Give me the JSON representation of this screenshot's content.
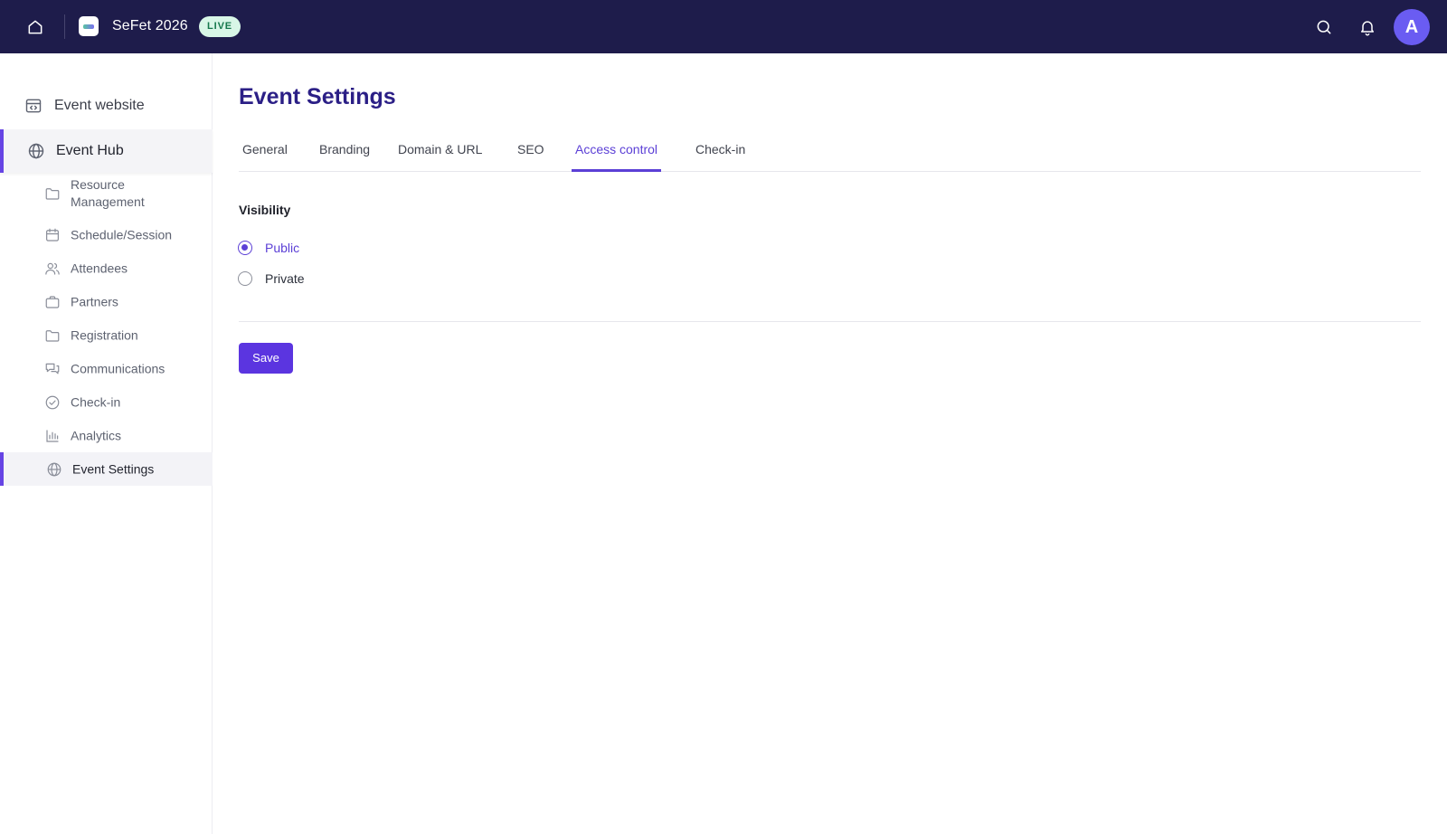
{
  "topbar": {
    "event_name": "SeFet 2026",
    "status_badge": "LIVE",
    "avatar_initial": "A",
    "icons": [
      "home-icon",
      "search-icon",
      "bell-icon"
    ]
  },
  "sidebar": {
    "event_website": "Event website",
    "event_hub": "Event Hub",
    "items": [
      {
        "label": "Resource Management",
        "icon": "folder-icon"
      },
      {
        "label": "Schedule/Session",
        "icon": "calendar-icon"
      },
      {
        "label": "Attendees",
        "icon": "users-icon"
      },
      {
        "label": "Partners",
        "icon": "briefcase-icon"
      },
      {
        "label": "Registration",
        "icon": "folder-icon"
      },
      {
        "label": "Communications",
        "icon": "chat-icon"
      },
      {
        "label": "Check-in",
        "icon": "check-circle-icon"
      },
      {
        "label": "Analytics",
        "icon": "bar-chart-icon"
      },
      {
        "label": "Event Settings",
        "icon": "globe-icon",
        "active": true
      }
    ]
  },
  "main": {
    "title": "Event Settings",
    "tabs": [
      "General",
      "Branding",
      "Domain & URL",
      "SEO",
      "Access control",
      "Check-in"
    ],
    "active_tab": "Access control",
    "visibility_label": "Visibility",
    "options": [
      {
        "label": "Public",
        "checked": true
      },
      {
        "label": "Private",
        "checked": false
      }
    ],
    "save_label": "Save"
  },
  "colors": {
    "topbar_bg": "#1e1c4b",
    "accent": "#5b35e0",
    "title": "#2b1f86",
    "live_badge_bg": "#d8f6e7",
    "live_badge_text": "#15784c",
    "avatar_bg": "#6a5cf2"
  }
}
